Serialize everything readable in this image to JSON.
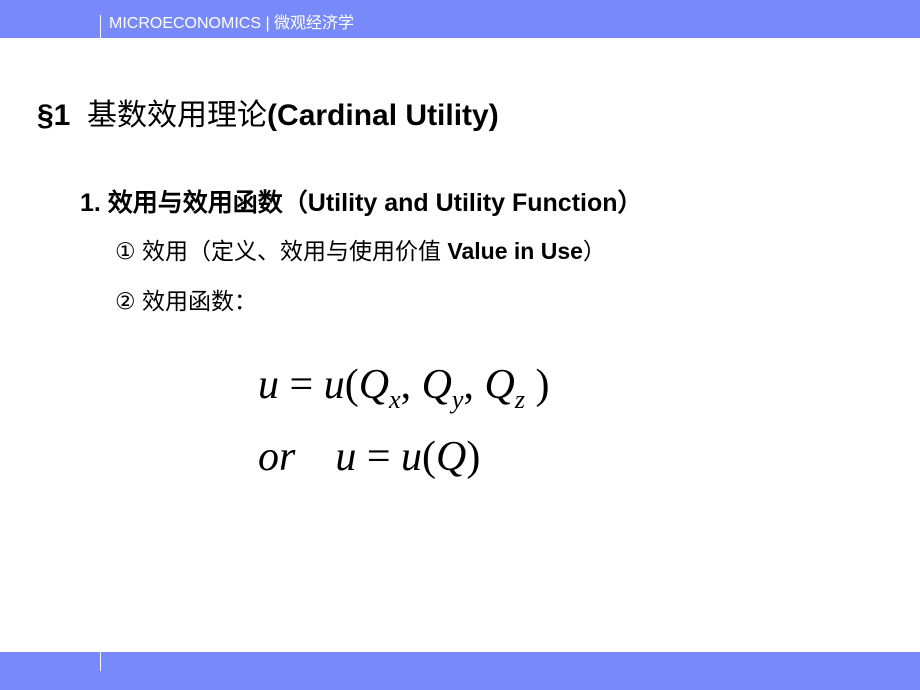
{
  "header": {
    "course_label": "MICROECONOMICS | 微观经济学",
    "bar_color": "#7889f9"
  },
  "footer": {
    "bar_color": "#7889f9"
  },
  "slide": {
    "title": {
      "section": "§1",
      "chinese": "基数效用理论",
      "english": "(Cardinal Utility)"
    },
    "heading": "1.  效用与效用函数（Utility and Utility Function）",
    "items": [
      {
        "marker": "①",
        "text_cn": " 效用（定义、效用与使用价值 ",
        "text_en": "Value in Use",
        "text_end": "）"
      },
      {
        "marker": "②",
        "text_cn": " 效用函数：",
        "text_en": "",
        "text_end": ""
      }
    ],
    "formulas": {
      "line1": {
        "lhs": "u",
        "eq": " = ",
        "func": "u",
        "open": "(",
        "var": "Q",
        "sub_x": "x",
        "sub_y": "y",
        "sub_z": "z",
        "comma": ", ",
        "close": " )"
      },
      "line2": {
        "or": "or",
        "lhs": "u",
        "eq": " = ",
        "func": "u",
        "open": "(",
        "var": "Q",
        "close": ")"
      }
    }
  }
}
